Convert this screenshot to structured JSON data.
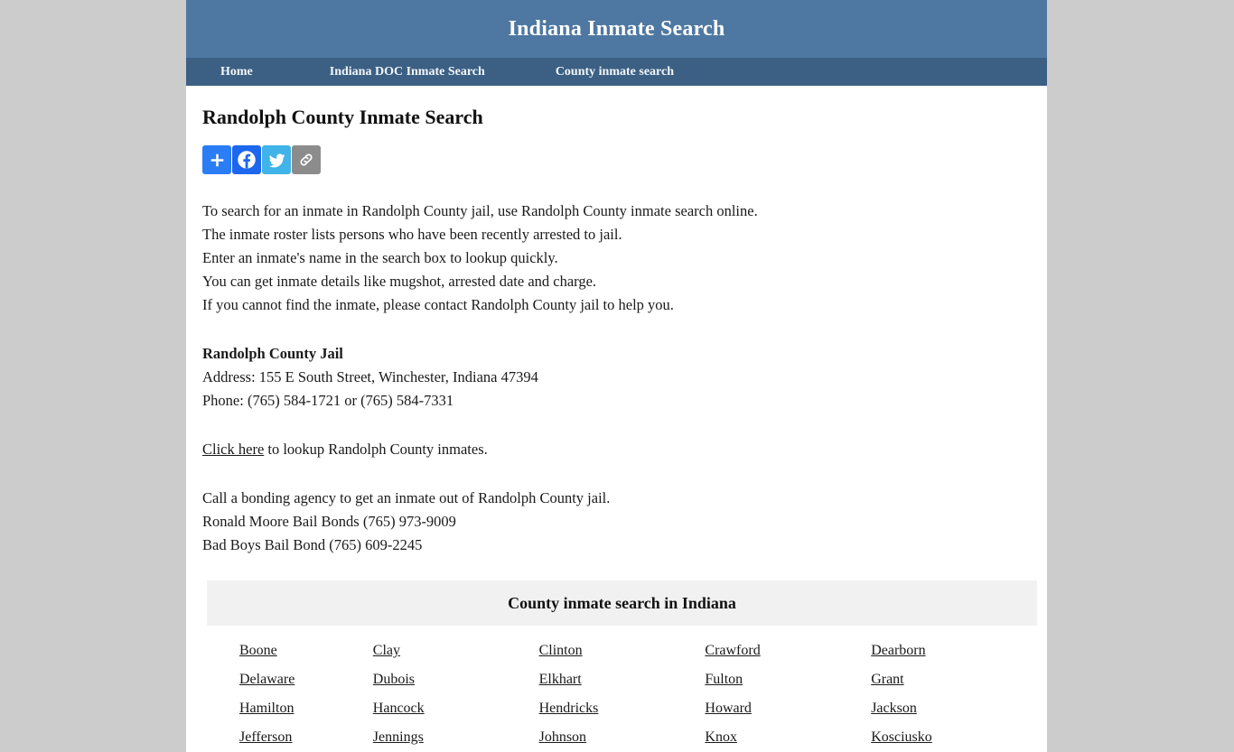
{
  "header": {
    "site_title": "Indiana Inmate Search"
  },
  "nav": {
    "items": [
      {
        "label": "Home",
        "name": "nav-home"
      },
      {
        "label": "Indiana DOC Inmate Search",
        "name": "nav-doc-inmate-search"
      },
      {
        "label": "County inmate search",
        "name": "nav-county-inmate-search"
      }
    ]
  },
  "main": {
    "page_title": "Randolph County Inmate Search",
    "share": {
      "buttons": [
        {
          "label": "Share",
          "icon": "plus-icon",
          "color": "#2a7df4"
        },
        {
          "label": "Facebook",
          "icon": "facebook-icon",
          "color": "#1c67ec"
        },
        {
          "label": "Twitter",
          "icon": "twitter-icon",
          "color": "#40b3e8"
        },
        {
          "label": "Copy Link",
          "icon": "link-icon",
          "color": "#8c8c8c"
        }
      ]
    },
    "intro_lines": [
      "To search for an inmate in Randolph County jail, use Randolph County inmate search online.",
      "The inmate roster lists persons who have been recently arrested to jail.",
      "Enter an inmate's name in the search box to lookup quickly.",
      "You can get inmate details like mugshot, arrested date and charge.",
      "If you cannot find the inmate, please contact Randolph County jail to help you."
    ],
    "jail": {
      "name": "Randolph County Jail",
      "address": "Address: 155 E South Street, Winchester, Indiana 47394",
      "phone": "Phone: (765) 584-1721 or (765) 584-7331"
    },
    "lookup": {
      "link_text": "Click here",
      "suffix": " to lookup Randolph County inmates."
    },
    "bonding_lines": [
      "Call a bonding agency to get an inmate out of Randolph County jail.",
      "Ronald Moore Bail Bonds (765) 973-9009",
      "Bad Boys Bail Bond (765) 609-2245"
    ]
  },
  "county_table": {
    "title": "County inmate search in Indiana",
    "rows": [
      [
        "Boone",
        "Clay",
        "Clinton",
        "Crawford",
        "Dearborn"
      ],
      [
        "Delaware",
        "Dubois",
        "Elkhart",
        "Fulton",
        "Grant"
      ],
      [
        "Hamilton",
        "Hancock",
        "Hendricks",
        "Howard",
        "Jackson"
      ],
      [
        "Jefferson",
        "Jennings",
        "Johnson",
        "Knox",
        "Kosciusko"
      ]
    ]
  },
  "colors": {
    "header_blue": "#4e78a1",
    "nav_blue": "#3c6084",
    "page_background": "#cccccc",
    "table_head_gray": "#f1f1f1"
  }
}
